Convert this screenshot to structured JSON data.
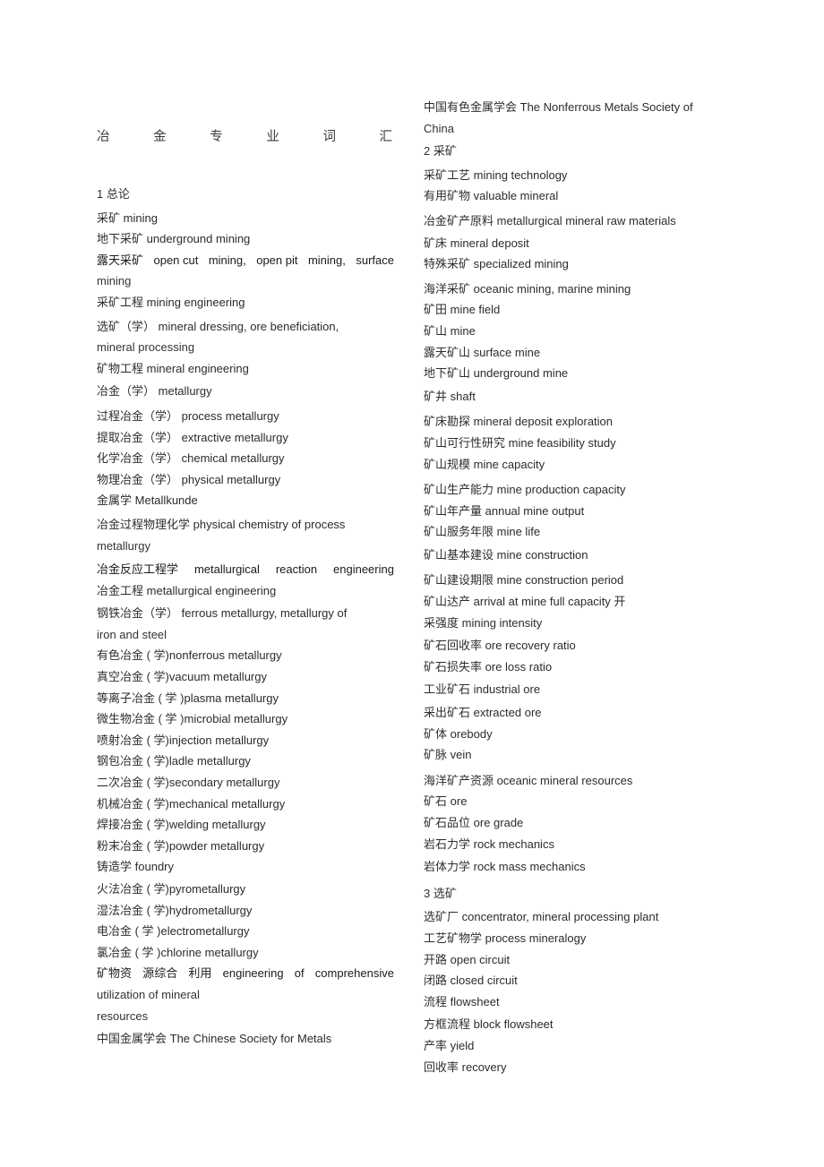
{
  "document": {
    "title_chars": [
      "冶",
      "金",
      "专",
      "业",
      "词",
      "汇"
    ],
    "title_plain": "冶金专业词汇"
  },
  "left_column": {
    "section_1_heading": "1 总论",
    "entries": [
      {
        "zh": "采矿",
        "en": "mining"
      },
      {
        "zh": "地下采矿",
        "en": "underground mining"
      },
      {
        "zh": "露天采矿",
        "en": "open cut mining,   open pit   mining,   surface mining",
        "justify_parts": [
          "露天采矿",
          "open cut",
          "mining,",
          "open pit",
          "mining,",
          "surface"
        ],
        "cont": "mining"
      },
      {
        "zh": "采矿工程",
        "en": "mining engineering"
      },
      {
        "zh": "选矿（学）",
        "en": "mineral dressing, ore beneficiation,",
        "cont": "mineral processing"
      },
      {
        "zh": "矿物工程",
        "en": "mineral engineering"
      },
      {
        "zh": "冶金（学）",
        "en": "metallurgy"
      },
      {
        "zh": "过程冶金（学）",
        "en": "process metallurgy"
      },
      {
        "zh": "提取冶金（学）",
        "en": "extractive metallurgy"
      },
      {
        "zh": "化学冶金（学）",
        "en": "chemical metallurgy"
      },
      {
        "zh": "物理冶金（学）",
        "en": "physical metallurgy"
      },
      {
        "zh": "金属学",
        "en": "Metallkunde"
      },
      {
        "zh": "冶金过程物理化学",
        "en": "physical chemistry of process",
        "cont": "metallurgy"
      },
      {
        "zh": "冶金反应工程学",
        "en": "metallurgical   reaction   engineering",
        "justify_parts": [
          "冶金反应工程学",
          "metallurgical",
          "reaction",
          "engineering"
        ]
      },
      {
        "zh": "冶金工程",
        "en": "metallurgical engineering"
      },
      {
        "zh": "钢铁冶金（学）",
        "en": "ferrous metallurgy, metallurgy of",
        "cont": "iron and steel"
      },
      {
        "zh": "有色冶金 ( 学)",
        "en": "nonferrous metallurgy",
        "tight": true
      },
      {
        "zh": "真空冶金 ( 学)",
        "en": "vacuum metallurgy",
        "tight": true
      },
      {
        "zh": "等离子冶金 ( 学 )",
        "en": "plasma metallurgy",
        "tight": true
      },
      {
        "zh": "微生物冶金 ( 学 )",
        "en": "microbial metallurgy",
        "tight": true
      },
      {
        "zh": "喷射冶金 ( 学)",
        "en": "injection metallurgy",
        "tight": true
      },
      {
        "zh": "钢包冶金 ( 学)",
        "en": "ladle metallurgy",
        "tight": true
      },
      {
        "zh": "二次冶金 ( 学)",
        "en": "secondary metallurgy",
        "tight": true
      },
      {
        "zh": "机械冶金 ( 学)",
        "en": "mechanical metallurgy",
        "tight": true
      },
      {
        "zh": "焊接冶金 ( 学)",
        "en": "welding metallurgy",
        "tight": true
      },
      {
        "zh": "粉末冶金 ( 学)",
        "en": "powder metallurgy",
        "tight": true
      },
      {
        "zh": "铸造学",
        "en": "foundry"
      },
      {
        "zh": "火法冶金 ( 学)",
        "en": "pyrometallurgy",
        "tight": true
      },
      {
        "zh": "湿法冶金 ( 学)",
        "en": "hydrometallurgy",
        "tight": true
      },
      {
        "zh": "电冶金 ( 学 )",
        "en": "electrometallurgy",
        "tight": true
      },
      {
        "zh": "氯冶金 ( 学 )",
        "en": "chlorine metallurgy",
        "tight": true
      },
      {
        "zh": "矿物资 源综合 利用",
        "en": "engineering   of   comprehensive",
        "justify_parts": [
          "矿物资",
          "源综合",
          "利用",
          "engineering",
          "of",
          "comprehensive"
        ],
        "cont": "utilization of mineral",
        "cont2": "resources"
      },
      {
        "zh": "中国金属学会",
        "en": "The Chinese Society for Metals"
      }
    ]
  },
  "right_column": {
    "section_2_heading": "2  采矿",
    "section_3_heading": "3  选矿",
    "entries_top": [
      {
        "zh": "中国有色金属学会",
        "en": "The Nonferrous Metals Society of",
        "cont": "China"
      }
    ],
    "entries_section_2": [
      {
        "zh": "采矿工艺",
        "en": "mining technology"
      },
      {
        "zh": "有用矿物",
        "en": "valuable mineral"
      },
      {
        "zh": "冶金矿产原料",
        "en": "metallurgical mineral raw materials"
      },
      {
        "zh": "矿床",
        "en": "mineral deposit"
      },
      {
        "zh": "特殊采矿",
        "en": "specialized mining"
      },
      {
        "zh": "海洋采矿",
        "en": "oceanic mining, marine mining"
      },
      {
        "zh": "矿田",
        "en": "mine field"
      },
      {
        "zh": "矿山",
        "en": "mine"
      },
      {
        "zh": "露天矿山",
        "en": "surface mine"
      },
      {
        "zh": "地下矿山",
        "en": "underground mine"
      },
      {
        "zh": "矿井",
        "en": "shaft"
      },
      {
        "zh": "矿床勘探",
        "en": "mineral deposit exploration"
      },
      {
        "zh": "矿山可行性研究",
        "en": "mine feasibility study"
      },
      {
        "zh": "矿山规模",
        "en": "mine capacity"
      },
      {
        "zh": "矿山生产能力",
        "en": "mine production capacity"
      },
      {
        "zh": "矿山年产量",
        "en": "annual mine output"
      },
      {
        "zh": "矿山服务年限",
        "en": "mine life"
      },
      {
        "zh": "矿山基本建设",
        "en": "mine construction"
      },
      {
        "zh": "矿山建设期限",
        "en": "mine construction period"
      },
      {
        "zh": "矿山达产",
        "en": "arrival at mine full capacity 开"
      },
      {
        "zh": "采强度",
        "en": "mining intensity"
      },
      {
        "zh": "矿石回收率",
        "en": "ore recovery ratio"
      },
      {
        "zh": "矿石损失率",
        "en": "ore loss ratio"
      },
      {
        "zh": "工业矿石",
        "en": "industrial ore"
      },
      {
        "zh": "采出矿石",
        "en": "extracted ore"
      },
      {
        "zh": "矿体",
        "en": "orebody"
      },
      {
        "zh": "矿脉",
        "en": "vein"
      },
      {
        "zh": "海洋矿产资源",
        "en": "oceanic mineral resources"
      },
      {
        "zh": "矿石",
        "en": "ore"
      },
      {
        "zh": "矿石品位",
        "en": "ore grade"
      },
      {
        "zh": "岩石力学",
        "en": "rock mechanics"
      },
      {
        "zh": "岩体力学",
        "en": "rock mass mechanics"
      }
    ],
    "entries_section_3": [
      {
        "zh": "选矿厂",
        "en": "concentrator, mineral processing plant"
      },
      {
        "zh": "工艺矿物学",
        "en": "process mineralogy"
      },
      {
        "zh": "开路",
        "en": "open circuit"
      },
      {
        "zh": "闭路",
        "en": "closed circuit"
      },
      {
        "zh": "流程",
        "en": "flowsheet"
      },
      {
        "zh": "方框流程",
        "en": "block flowsheet"
      },
      {
        "zh": "产率",
        "en": "yield"
      },
      {
        "zh": "回收率",
        "en": "recovery"
      }
    ]
  }
}
